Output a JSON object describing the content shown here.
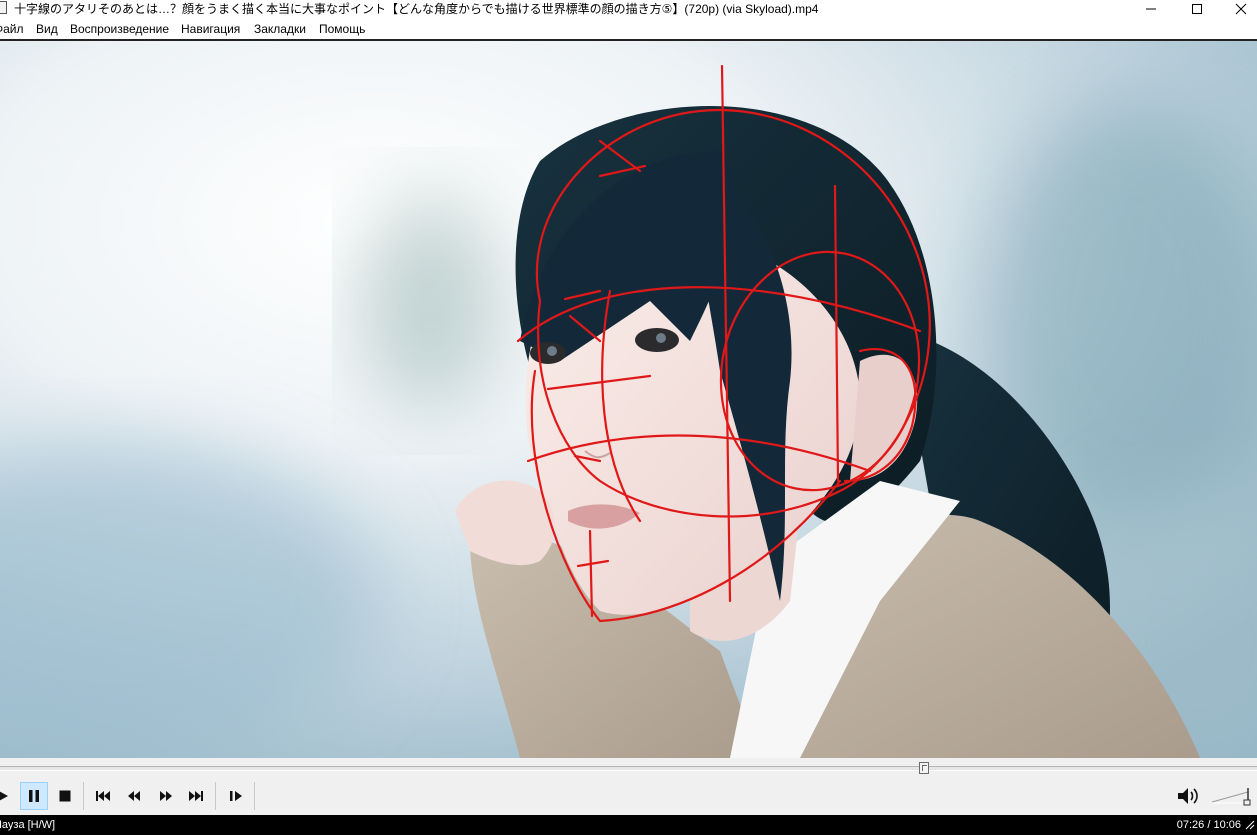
{
  "window": {
    "title": "十字線のアタリそのあとは…？顔をうまく描く本当に大事なポイント【どんな角度からでも描ける世界標準の顔の描き方⑤】(720p) (via Skyload).mp4",
    "minimize_icon": "minimize-icon",
    "maximize_icon": "maximize-icon",
    "close_icon": "close-icon"
  },
  "menu": {
    "items": [
      "Файл",
      "Вид",
      "Воспроизведение",
      "Навигация",
      "Закладки",
      "Помощь"
    ]
  },
  "video": {
    "content": "video-frame"
  },
  "seek": {
    "position_fraction": 0.735
  },
  "controls": {
    "play_icon": "play-icon",
    "pause_icon": "pause-icon",
    "stop_icon": "stop-icon",
    "prev_icon": "skip-previous-icon",
    "rewind_icon": "rewind-icon",
    "forward_icon": "fast-forward-icon",
    "next_icon": "skip-next-icon",
    "frame_step_icon": "frame-step-icon",
    "volume_icon": "speaker-icon"
  },
  "status": {
    "state": "Пауза [H/W]",
    "time": "07:26 / 10:06"
  },
  "colors": {
    "accent_active": "#cde8ff",
    "toolbar_bg": "#f0f0f0",
    "status_bg": "#000000",
    "sketch_red": "#e01818"
  }
}
